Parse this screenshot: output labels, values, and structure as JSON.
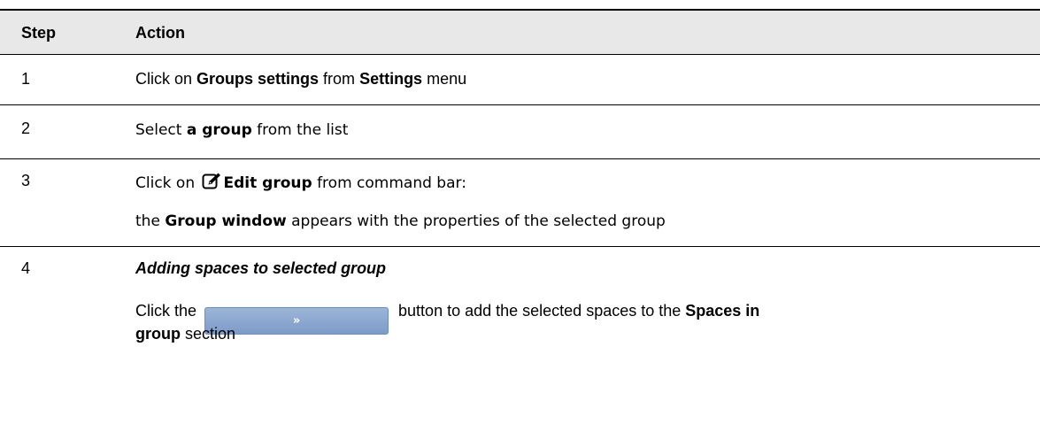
{
  "header": {
    "step": "Step",
    "action": "Action"
  },
  "rows": [
    {
      "num": "1",
      "line1": {
        "pre": "Click on ",
        "b1": "Groups settings",
        "mid": " from ",
        "b2": "Settings",
        "post": " menu"
      }
    },
    {
      "num": "2",
      "line1": {
        "pre": "Select ",
        "b1": "a group",
        "post": " from the list"
      }
    },
    {
      "num": "3",
      "line1": {
        "pre": "Click on ",
        "icon": "edit-icon",
        "b1": "Edit group",
        "post": " from command bar:"
      },
      "line2": {
        "pre": "the ",
        "b1": "Group window",
        "post": " appears with the properties of the selected group"
      }
    },
    {
      "num": "4",
      "heading": "Adding spaces to selected group",
      "line1": {
        "pre": "Click the ",
        "button_label": "»",
        "mid": " button to add the selected spaces to the ",
        "b1": "Spaces in"
      },
      "line2": {
        "b1": "group",
        "post": " section"
      }
    }
  ],
  "colors": {
    "header_bg": "#e8e8e8",
    "button_fill": "#8ba7d0"
  }
}
